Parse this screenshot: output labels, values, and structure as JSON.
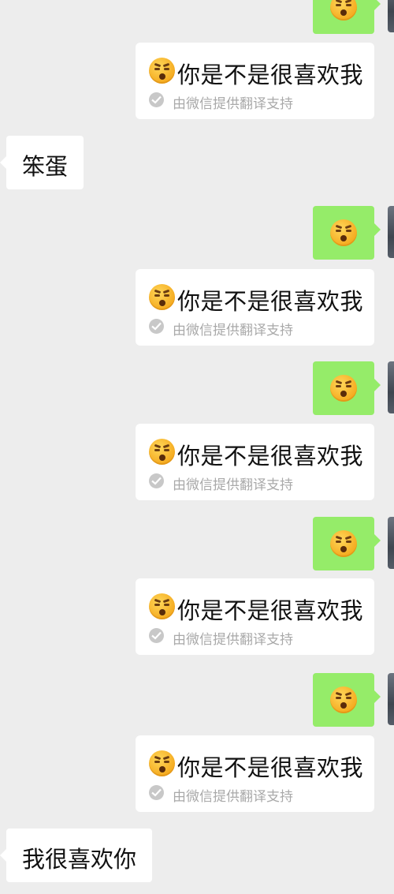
{
  "messages": {
    "translation_text": "你是不是很喜欢我",
    "translation_source": "由微信提供翻译支持",
    "received_1": "笨蛋",
    "received_2": "我很喜欢你"
  },
  "icons": {
    "emoji": "face-emoji-icon",
    "check": "check-circle-icon"
  },
  "colors": {
    "background": "#ededed",
    "sent_bubble": "#95ec69",
    "received_bubble": "#ffffff"
  }
}
